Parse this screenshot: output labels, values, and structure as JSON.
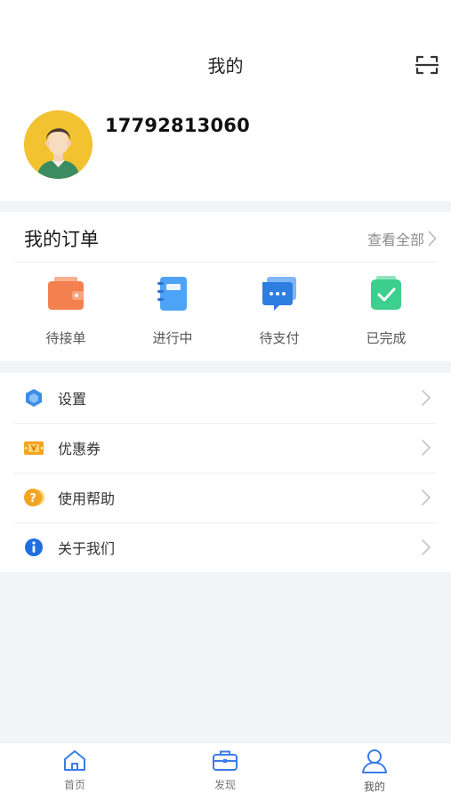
{
  "header": {
    "title": "我的",
    "scan_icon": "scan-icon"
  },
  "profile": {
    "phone": "17792813060",
    "avatar_icon": "user-avatar"
  },
  "orders": {
    "title": "我的订单",
    "view_all": "查看全部",
    "items": [
      {
        "label": "待接单",
        "icon": "wallet-icon",
        "color": "#f47f4f"
      },
      {
        "label": "进行中",
        "icon": "notebook-icon",
        "color": "#4da3f5"
      },
      {
        "label": "待支付",
        "icon": "chat-bubble-icon",
        "color": "#2e7de0"
      },
      {
        "label": "已完成",
        "icon": "check-bag-icon",
        "color": "#3ccf8e"
      }
    ]
  },
  "menu": [
    {
      "label": "设置",
      "icon": "settings-icon",
      "color": "#3c8ee8"
    },
    {
      "label": "优惠券",
      "icon": "coupon-icon",
      "color": "#f3a422"
    },
    {
      "label": "使用帮助",
      "icon": "help-icon",
      "color": "#f3a422"
    },
    {
      "label": "关于我们",
      "icon": "info-icon",
      "color": "#1f6fe0"
    }
  ],
  "tabbar": [
    {
      "label": "首页",
      "icon": "home-icon"
    },
    {
      "label": "发现",
      "icon": "briefcase-icon"
    },
    {
      "label": "我的",
      "icon": "user-icon"
    }
  ],
  "colors": {
    "accent": "#3c7be8",
    "background": "#f2f4f6"
  }
}
